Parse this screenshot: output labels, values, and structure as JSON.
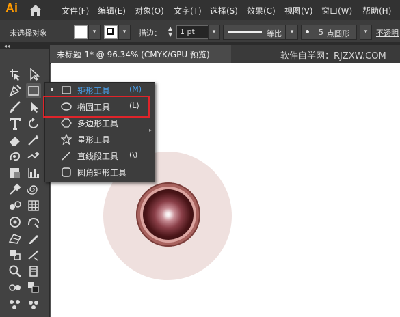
{
  "app": {
    "logo": "Ai"
  },
  "menu": [
    "文件(F)",
    "编辑(E)",
    "对象(O)",
    "文字(T)",
    "选择(S)",
    "效果(C)",
    "视图(V)",
    "窗口(W)",
    "帮助(H)"
  ],
  "control_bar": {
    "selection_status": "未选择对象",
    "stroke_label": "描边：",
    "stroke_value": "1 pt",
    "stroke_profile": "等比",
    "brush_count": "5",
    "brush_label": "点圆形",
    "opacity_label": "不透明"
  },
  "document": {
    "tab_title": "未标题-1* @ 96.34% (CMYK/GPU 预览)",
    "watermark": "软件自学网：RJZXW.COM"
  },
  "flyout": {
    "items": [
      {
        "label": "矩形工具",
        "shortcut": "(M)",
        "icon": "rectangle-icon",
        "active": true
      },
      {
        "label": "椭圆工具",
        "shortcut": "(L)",
        "icon": "ellipse-icon",
        "highlighted": true
      },
      {
        "label": "多边形工具",
        "shortcut": "",
        "icon": "polygon-icon"
      },
      {
        "label": "星形工具",
        "shortcut": "",
        "icon": "star-icon"
      },
      {
        "label": "直线段工具",
        "shortcut": "(\\)",
        "icon": "line-segment-icon"
      },
      {
        "label": "圆角矩形工具",
        "shortcut": "",
        "icon": "rounded-rectangle-icon"
      }
    ]
  },
  "colors": {
    "active_item": "#4a9ee8",
    "highlight_box": "#e0242a",
    "outer_glow": "#f0e2e0",
    "ring": "#a8625e"
  }
}
